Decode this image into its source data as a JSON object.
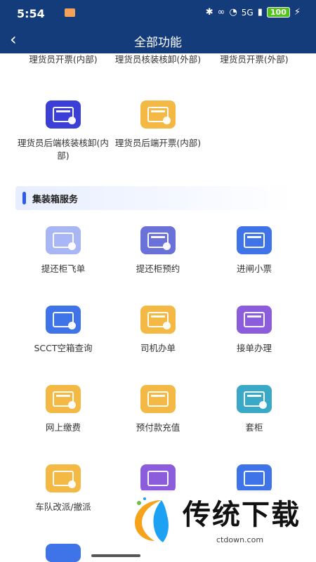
{
  "status_bar": {
    "time": "5:54",
    "signal": "5G",
    "battery": "100"
  },
  "header": {
    "back_icon": "‹",
    "title": "全部功能"
  },
  "top_labels": {
    "col1": "理货员开票(内部)",
    "col2": "理货员核装核卸(外部)",
    "col3": "理货员开票(外部)"
  },
  "items_row1": [
    {
      "label": "理货员后端核装核卸(内部)",
      "color": "#3b3fd6",
      "icon": "ticket-search-icon"
    },
    {
      "label": "理货员后端开票(内部)",
      "color": "#f4b944",
      "icon": "ticket-icon"
    }
  ],
  "section": {
    "title": "集装箱服务"
  },
  "services": [
    {
      "label": "提还柜飞单",
      "color": "#a9b6f6",
      "icon": "camera-icon"
    },
    {
      "label": "提还柜预约",
      "color": "#6a71d8",
      "icon": "container-schedule-icon"
    },
    {
      "label": "进闸小票",
      "color": "#3f73e8",
      "icon": "gate-entry-icon"
    },
    {
      "label": "SCCT空箱查询",
      "color": "#3f73e8",
      "icon": "box-search-icon"
    },
    {
      "label": "司机办单",
      "color": "#f4b944",
      "icon": "driver-document-icon"
    },
    {
      "label": "接单办理",
      "color": "#8b5cdb",
      "icon": "hand-order-icon"
    },
    {
      "label": "网上缴费",
      "color": "#f4b944",
      "icon": "payment-icon"
    },
    {
      "label": "预付款充值",
      "color": "#f4b944",
      "icon": "prepaid-icon"
    },
    {
      "label": "套柜",
      "color": "#3aa8c7",
      "icon": "container-icon"
    },
    {
      "label": "车队改派/撤派",
      "color": "#f4b944",
      "icon": "reassign-icon"
    },
    {
      "label": "",
      "color": "#8b5cdb",
      "icon": "clipboard-icon"
    },
    {
      "label": "",
      "color": "#3f73e8",
      "icon": "document-icon"
    },
    {
      "label": "",
      "color": "#3f73e8",
      "icon": "partial-icon"
    }
  ],
  "watermark": {
    "title": "传统下载",
    "url": "ctdown.com"
  }
}
